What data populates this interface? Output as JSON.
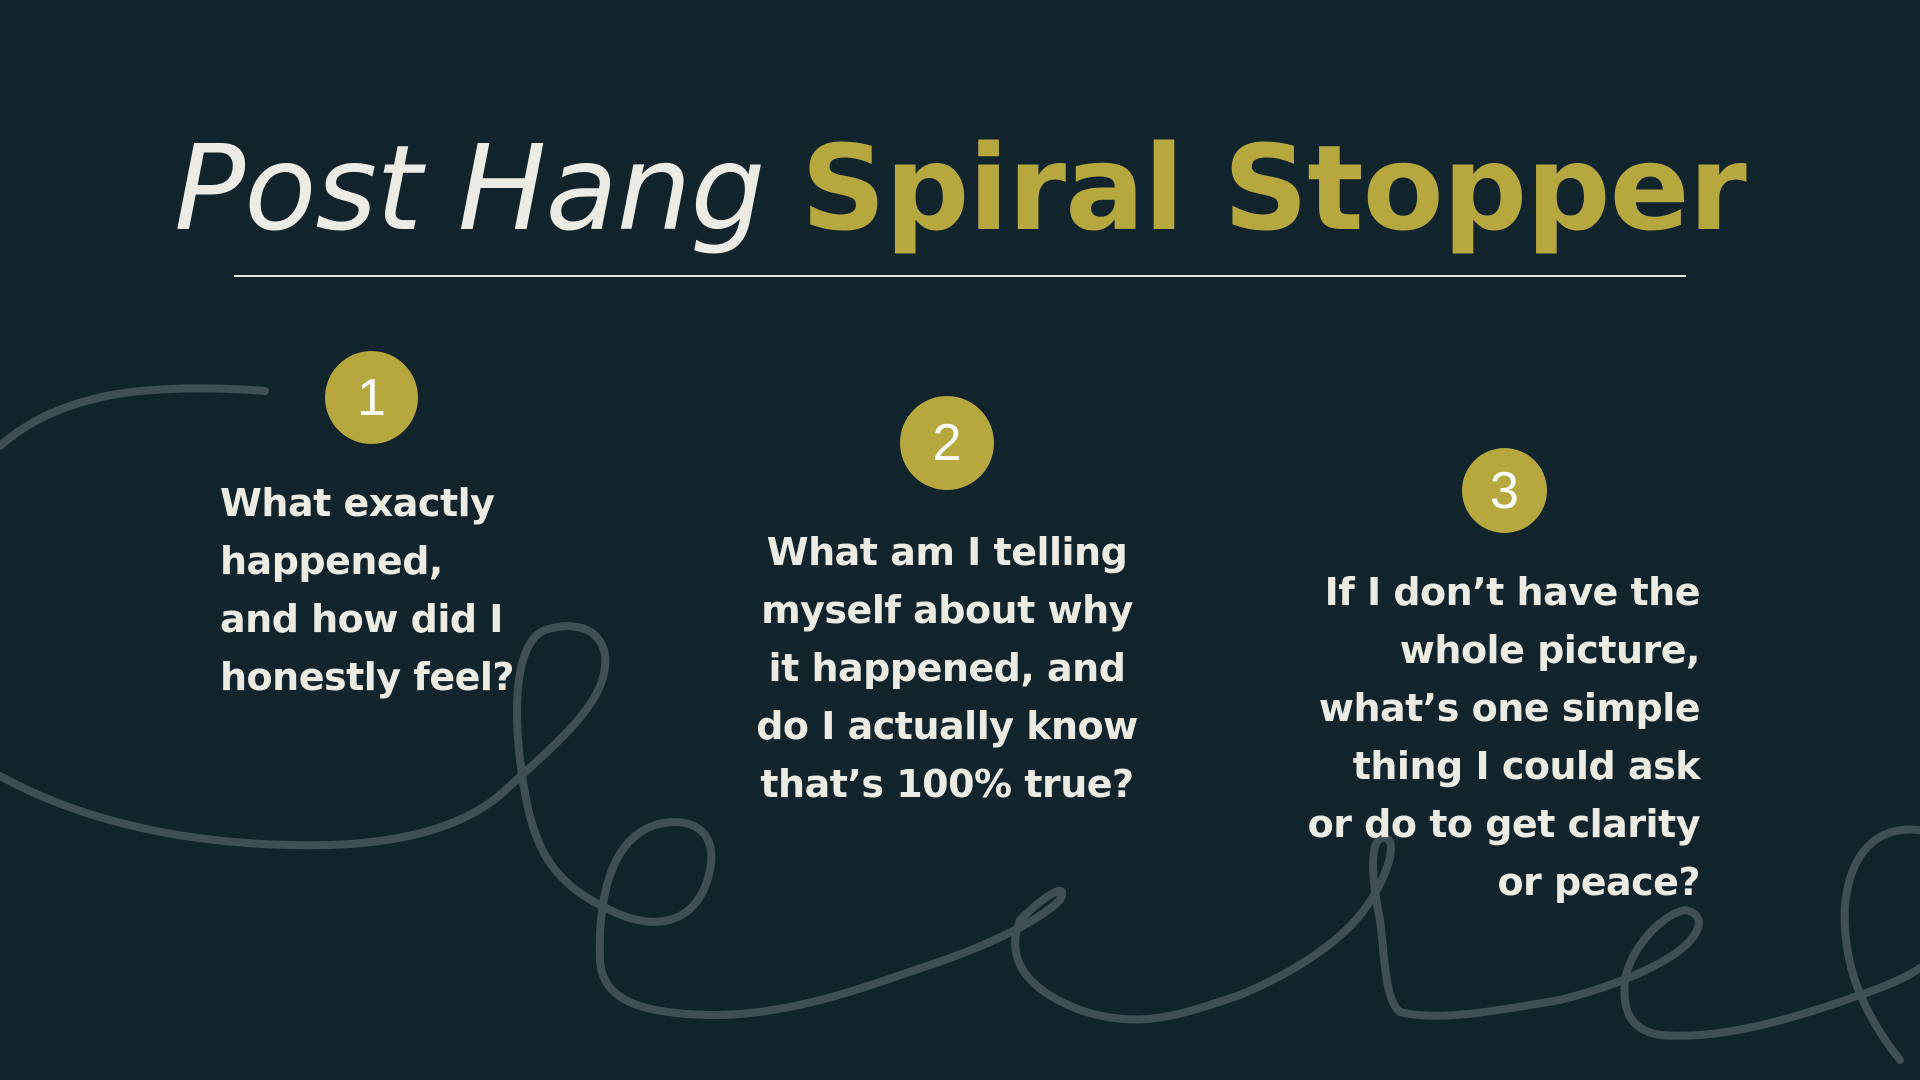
{
  "title": {
    "light": "Post Hang",
    "bold": "Spiral Stopper"
  },
  "steps": [
    {
      "number": "1",
      "text": "What exactly\nhappened,\nand how did I\nhonestly feel?"
    },
    {
      "number": "2",
      "text": "What am I telling\nmyself about why\nit happened, and\ndo I actually know\nthat’s 100% true?"
    },
    {
      "number": "3",
      "text": "If I don’t have the\nwhole picture,\nwhat’s one simple\nthing I could ask\nor do to get clarity\nor peace?"
    }
  ],
  "colors": {
    "background": "#11232b",
    "accent": "#b7a73f",
    "text": "#ecebe4",
    "squiggle": "#3f4f55"
  },
  "decoration": "hand-drawn-squiggle-line"
}
